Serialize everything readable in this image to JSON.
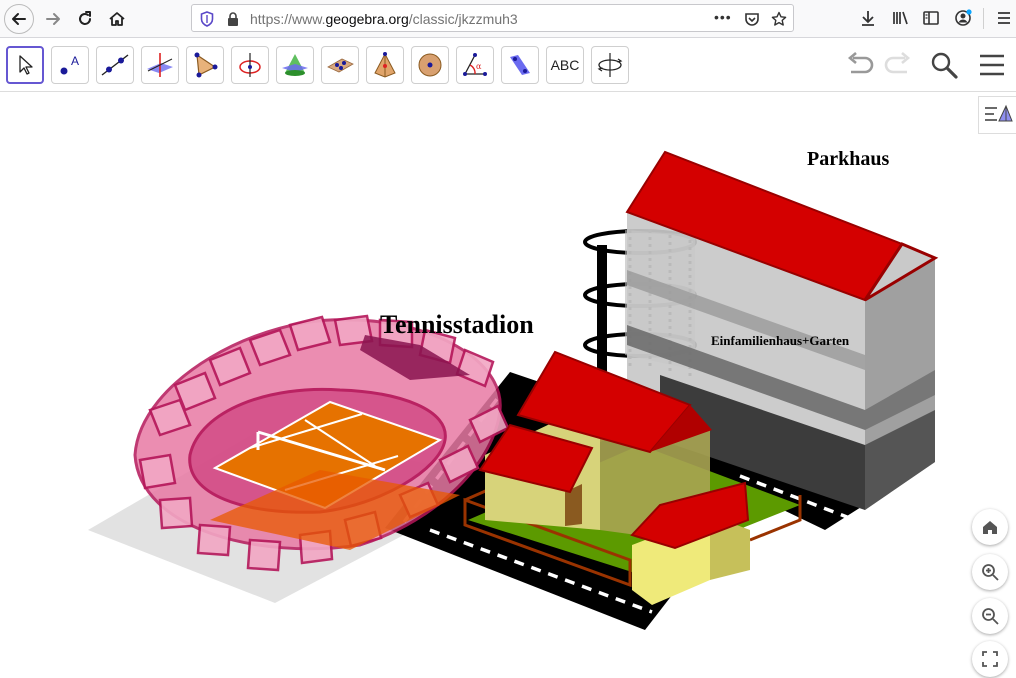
{
  "browser": {
    "url_prefix": "https://www.",
    "url_host": "geogebra.org",
    "url_path": "/classic/jkzzmuh3",
    "url_more": "•••"
  },
  "toolbar": {
    "tools": [
      {
        "name": "move-tool",
        "icon": "cursor-arrow-icon"
      },
      {
        "name": "point-tool",
        "icon": "point-icon"
      },
      {
        "name": "line-tool",
        "icon": "line-icon"
      },
      {
        "name": "perpendicular-tool",
        "icon": "perpendicular-plane-icon"
      },
      {
        "name": "polygon-tool",
        "icon": "polygon-icon"
      },
      {
        "name": "circle-axis-tool",
        "icon": "circle-axis-icon"
      },
      {
        "name": "intersect-surfaces-tool",
        "icon": "intersect-surfaces-icon"
      },
      {
        "name": "plane-three-points-tool",
        "icon": "plane-points-icon"
      },
      {
        "name": "pyramid-tool",
        "icon": "pyramid-icon"
      },
      {
        "name": "sphere-tool",
        "icon": "sphere-icon"
      },
      {
        "name": "angle-tool",
        "icon": "angle-icon"
      },
      {
        "name": "reflect-plane-tool",
        "icon": "reflect-plane-icon"
      },
      {
        "name": "text-tool",
        "icon": "text-icon",
        "label": "ABC"
      },
      {
        "name": "rotate-view-tool",
        "icon": "rotate-view-icon"
      }
    ]
  },
  "labels": {
    "tennis": "Tennisstadion",
    "parking": "Parkhaus",
    "house": "Einfamilienhaus+Garten"
  },
  "colors": {
    "roof_red": "#d40000",
    "stadium_pink": "#c8326e",
    "court_orange": "#e06400",
    "house_yellow": "#e9e58c",
    "garden_green": "#5c9a00",
    "accent_purple": "#6557d2"
  }
}
